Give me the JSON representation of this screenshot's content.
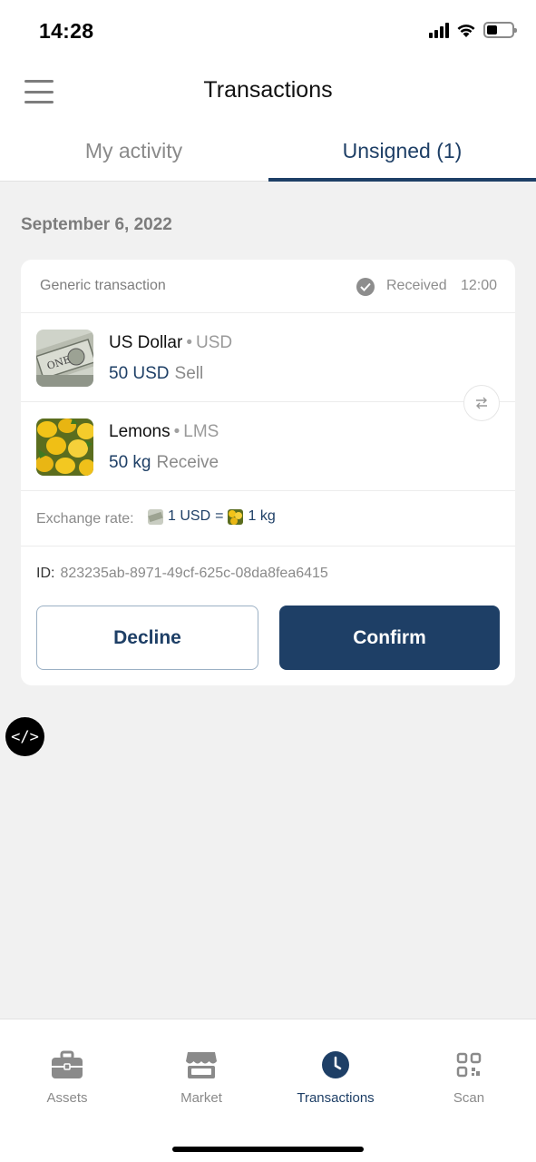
{
  "status_bar": {
    "time": "14:28"
  },
  "header": {
    "title": "Transactions"
  },
  "tabs": [
    {
      "label": "My activity",
      "active": false
    },
    {
      "label": "Unsigned (1)",
      "active": true
    }
  ],
  "date_heading": "September 6, 2022",
  "transaction": {
    "type": "Generic transaction",
    "status": "Received",
    "time": "12:00",
    "assets": [
      {
        "name": "US Dollar",
        "code": "USD",
        "amount": "50 USD",
        "action": "Sell",
        "icon": "dollar-bill-image"
      },
      {
        "name": "Lemons",
        "code": "LMS",
        "amount": "50 kg",
        "action": "Receive",
        "icon": "lemons-image"
      }
    ],
    "exchange_rate": {
      "label": "Exchange rate:",
      "from": "1 USD",
      "equals": "=",
      "to": "1 kg"
    },
    "id": {
      "label": "ID:",
      "value": "823235ab-8971-49cf-625c-08da8fea6415"
    },
    "decline_label": "Decline",
    "confirm_label": "Confirm"
  },
  "dev_badge": "</>",
  "bottom_nav": [
    {
      "label": "Assets",
      "icon": "briefcase-icon",
      "active": false
    },
    {
      "label": "Market",
      "icon": "store-icon",
      "active": false
    },
    {
      "label": "Transactions",
      "icon": "clock-icon",
      "active": true
    },
    {
      "label": "Scan",
      "icon": "qr-code-icon",
      "active": false
    }
  ],
  "colors": {
    "accent": "#1e3f66",
    "background": "#f1f1f1",
    "muted": "#8a8a8a"
  }
}
